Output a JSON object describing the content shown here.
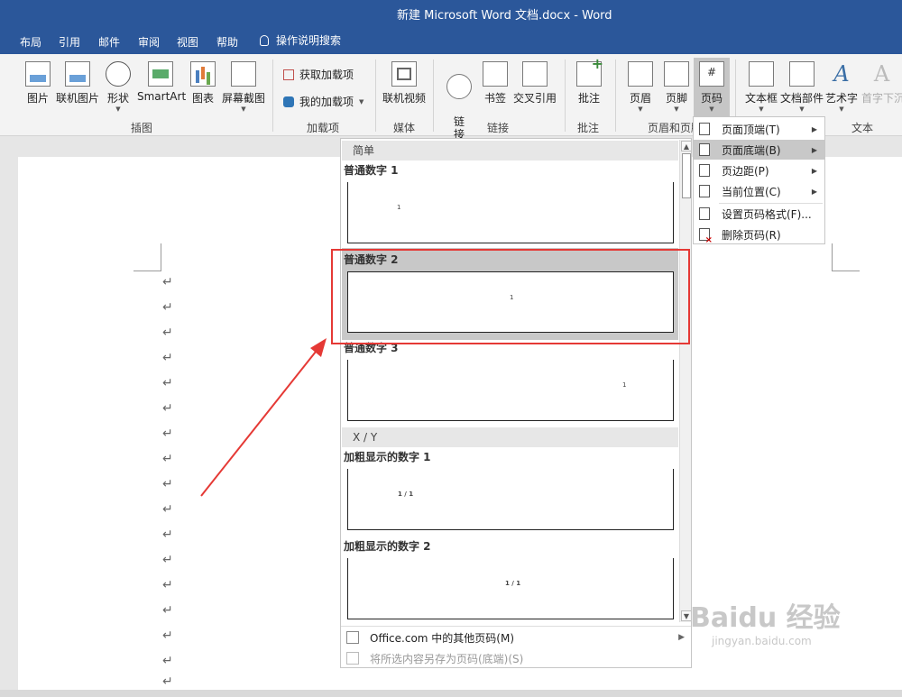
{
  "window": {
    "title": "新建 Microsoft Word 文档.docx  -  Word"
  },
  "menubar": {
    "tabs": [
      "布局",
      "引用",
      "邮件",
      "审阅",
      "视图",
      "帮助"
    ],
    "tell_me": "操作说明搜索"
  },
  "ribbon": {
    "buttons": {
      "picture": "图片",
      "online_picture": "联机图片",
      "shapes": "形状",
      "smartart": "SmartArt",
      "chart": "图表",
      "screenshot": "屏幕截图",
      "online_video": "联机视频",
      "link": "链\n接",
      "bookmark": "书签",
      "cross_ref": "交叉引用",
      "comment": "批注",
      "header": "页眉",
      "footer": "页脚",
      "page_number": "页码",
      "textbox": "文本框",
      "quick_parts": "文档部件",
      "wordart": "艺术字",
      "dropcap": "首字下沉"
    },
    "addins": {
      "get": "获取加载项",
      "mine": "我的加载项"
    },
    "groups": {
      "illustrations": "插图",
      "addins": "加载项",
      "media": "媒体",
      "links": "链接",
      "comments": "批注",
      "header_footer": "页眉和页脚",
      "text": "文本"
    },
    "icons": {
      "wordart_glyph": "A"
    }
  },
  "document": {
    "paragraph_mark": "↵"
  },
  "gallery": {
    "section_simple": "简单",
    "section_xy": "X / Y",
    "items": [
      {
        "title": "普通数字 1",
        "preview": "1"
      },
      {
        "title": "普通数字 2",
        "preview": "1"
      },
      {
        "title": "普通数字 3",
        "preview": "1"
      },
      {
        "title": "加粗显示的数字 1",
        "preview": "1 / 1"
      },
      {
        "title": "加粗显示的数字 2",
        "preview": "1 / 1"
      }
    ],
    "footer": {
      "more": "Office.com 中的其他页码(M)",
      "save": "将所选内容另存为页码(底端)(S)"
    }
  },
  "submenu": {
    "items": [
      {
        "label": "页面顶端(T)",
        "arrow": "▶"
      },
      {
        "label": "页面底端(B)",
        "arrow": "▶"
      },
      {
        "label": "页边距(P)",
        "arrow": "▶"
      },
      {
        "label": "当前位置(C)",
        "arrow": "▶"
      },
      {
        "label": "设置页码格式(F)..."
      },
      {
        "label": "删除页码(R)"
      }
    ]
  },
  "watermark": {
    "brand": "Baidu 经验",
    "url": "jingyan.baidu.com"
  },
  "colors": {
    "title_bar": "#2b579a",
    "highlight_box": "#e53935",
    "selected_item": "#c8c8c8"
  }
}
